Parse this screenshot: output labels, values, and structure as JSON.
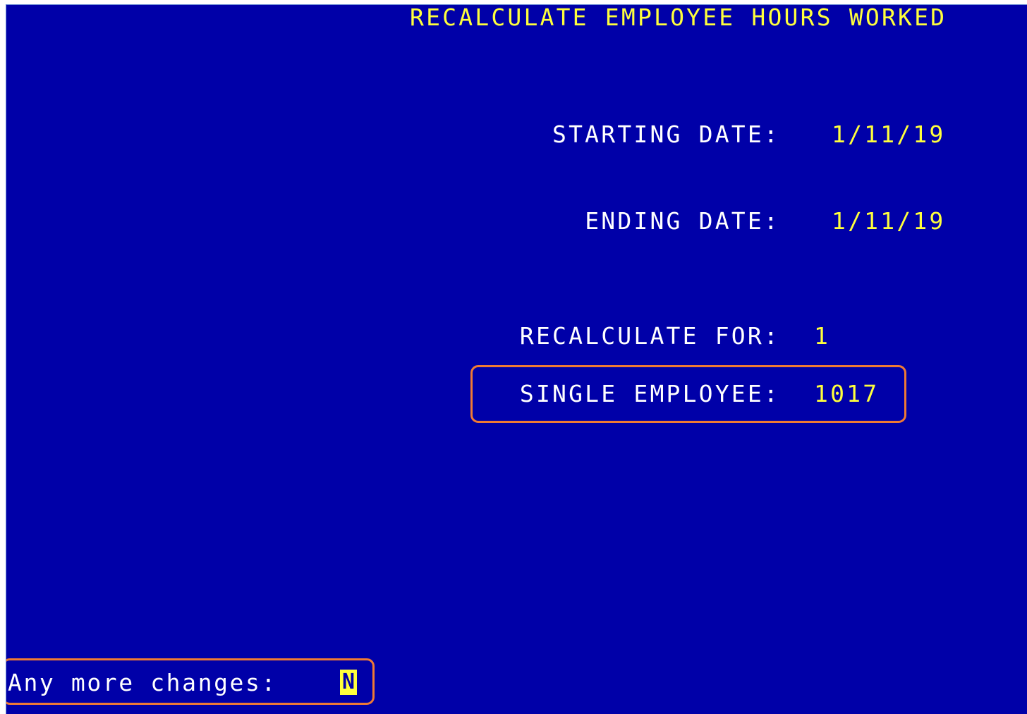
{
  "screen": {
    "title": "RECALCULATE EMPLOYEE HOURS WORKED",
    "fields": {
      "starting_date": {
        "label": "STARTING DATE:",
        "value": "1/11/19"
      },
      "ending_date": {
        "label": "ENDING DATE:",
        "value": "1/11/19"
      },
      "recalculate_for": {
        "label": "RECALCULATE FOR:",
        "value": "1"
      },
      "single_employee": {
        "label": "SINGLE EMPLOYEE:",
        "value": "1017"
      }
    },
    "prompt": {
      "label": "Any more changes:",
      "value": "N"
    }
  },
  "colors": {
    "background": "#0000a8",
    "label_text": "#ffffff",
    "value_text": "#ffff3c",
    "highlight_border": "#ef7a34"
  }
}
